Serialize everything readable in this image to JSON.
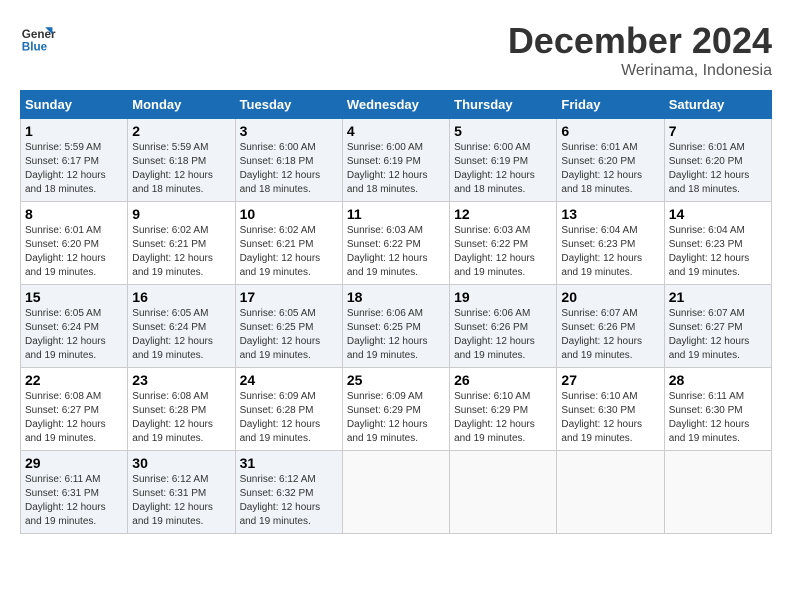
{
  "logo": {
    "line1": "General",
    "line2": "Blue"
  },
  "title": "December 2024",
  "location": "Werinama, Indonesia",
  "days_of_week": [
    "Sunday",
    "Monday",
    "Tuesday",
    "Wednesday",
    "Thursday",
    "Friday",
    "Saturday"
  ],
  "weeks": [
    [
      {
        "day": "1",
        "info": "Sunrise: 5:59 AM\nSunset: 6:17 PM\nDaylight: 12 hours\nand 18 minutes."
      },
      {
        "day": "2",
        "info": "Sunrise: 5:59 AM\nSunset: 6:18 PM\nDaylight: 12 hours\nand 18 minutes."
      },
      {
        "day": "3",
        "info": "Sunrise: 6:00 AM\nSunset: 6:18 PM\nDaylight: 12 hours\nand 18 minutes."
      },
      {
        "day": "4",
        "info": "Sunrise: 6:00 AM\nSunset: 6:19 PM\nDaylight: 12 hours\nand 18 minutes."
      },
      {
        "day": "5",
        "info": "Sunrise: 6:00 AM\nSunset: 6:19 PM\nDaylight: 12 hours\nand 18 minutes."
      },
      {
        "day": "6",
        "info": "Sunrise: 6:01 AM\nSunset: 6:20 PM\nDaylight: 12 hours\nand 18 minutes."
      },
      {
        "day": "7",
        "info": "Sunrise: 6:01 AM\nSunset: 6:20 PM\nDaylight: 12 hours\nand 18 minutes."
      }
    ],
    [
      {
        "day": "8",
        "info": "Sunrise: 6:01 AM\nSunset: 6:20 PM\nDaylight: 12 hours\nand 19 minutes."
      },
      {
        "day": "9",
        "info": "Sunrise: 6:02 AM\nSunset: 6:21 PM\nDaylight: 12 hours\nand 19 minutes."
      },
      {
        "day": "10",
        "info": "Sunrise: 6:02 AM\nSunset: 6:21 PM\nDaylight: 12 hours\nand 19 minutes."
      },
      {
        "day": "11",
        "info": "Sunrise: 6:03 AM\nSunset: 6:22 PM\nDaylight: 12 hours\nand 19 minutes."
      },
      {
        "day": "12",
        "info": "Sunrise: 6:03 AM\nSunset: 6:22 PM\nDaylight: 12 hours\nand 19 minutes."
      },
      {
        "day": "13",
        "info": "Sunrise: 6:04 AM\nSunset: 6:23 PM\nDaylight: 12 hours\nand 19 minutes."
      },
      {
        "day": "14",
        "info": "Sunrise: 6:04 AM\nSunset: 6:23 PM\nDaylight: 12 hours\nand 19 minutes."
      }
    ],
    [
      {
        "day": "15",
        "info": "Sunrise: 6:05 AM\nSunset: 6:24 PM\nDaylight: 12 hours\nand 19 minutes."
      },
      {
        "day": "16",
        "info": "Sunrise: 6:05 AM\nSunset: 6:24 PM\nDaylight: 12 hours\nand 19 minutes."
      },
      {
        "day": "17",
        "info": "Sunrise: 6:05 AM\nSunset: 6:25 PM\nDaylight: 12 hours\nand 19 minutes."
      },
      {
        "day": "18",
        "info": "Sunrise: 6:06 AM\nSunset: 6:25 PM\nDaylight: 12 hours\nand 19 minutes."
      },
      {
        "day": "19",
        "info": "Sunrise: 6:06 AM\nSunset: 6:26 PM\nDaylight: 12 hours\nand 19 minutes."
      },
      {
        "day": "20",
        "info": "Sunrise: 6:07 AM\nSunset: 6:26 PM\nDaylight: 12 hours\nand 19 minutes."
      },
      {
        "day": "21",
        "info": "Sunrise: 6:07 AM\nSunset: 6:27 PM\nDaylight: 12 hours\nand 19 minutes."
      }
    ],
    [
      {
        "day": "22",
        "info": "Sunrise: 6:08 AM\nSunset: 6:27 PM\nDaylight: 12 hours\nand 19 minutes."
      },
      {
        "day": "23",
        "info": "Sunrise: 6:08 AM\nSunset: 6:28 PM\nDaylight: 12 hours\nand 19 minutes."
      },
      {
        "day": "24",
        "info": "Sunrise: 6:09 AM\nSunset: 6:28 PM\nDaylight: 12 hours\nand 19 minutes."
      },
      {
        "day": "25",
        "info": "Sunrise: 6:09 AM\nSunset: 6:29 PM\nDaylight: 12 hours\nand 19 minutes."
      },
      {
        "day": "26",
        "info": "Sunrise: 6:10 AM\nSunset: 6:29 PM\nDaylight: 12 hours\nand 19 minutes."
      },
      {
        "day": "27",
        "info": "Sunrise: 6:10 AM\nSunset: 6:30 PM\nDaylight: 12 hours\nand 19 minutes."
      },
      {
        "day": "28",
        "info": "Sunrise: 6:11 AM\nSunset: 6:30 PM\nDaylight: 12 hours\nand 19 minutes."
      }
    ],
    [
      {
        "day": "29",
        "info": "Sunrise: 6:11 AM\nSunset: 6:31 PM\nDaylight: 12 hours\nand 19 minutes."
      },
      {
        "day": "30",
        "info": "Sunrise: 6:12 AM\nSunset: 6:31 PM\nDaylight: 12 hours\nand 19 minutes."
      },
      {
        "day": "31",
        "info": "Sunrise: 6:12 AM\nSunset: 6:32 PM\nDaylight: 12 hours\nand 19 minutes."
      },
      {
        "day": "",
        "info": ""
      },
      {
        "day": "",
        "info": ""
      },
      {
        "day": "",
        "info": ""
      },
      {
        "day": "",
        "info": ""
      }
    ]
  ]
}
